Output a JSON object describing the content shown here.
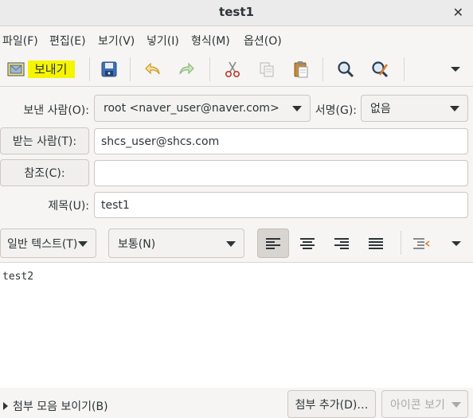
{
  "window": {
    "title": "test1"
  },
  "menu": [
    "파일(F)",
    "편집(E)",
    "보기(V)",
    "넣기(I)",
    "형식(M)",
    "옵션(O)"
  ],
  "toolbar": {
    "send_label": "보내기"
  },
  "header": {
    "from_label": "보낸 사람(O):",
    "from_value": "root <naver_user@naver.com>",
    "signature_label": "서명(G):",
    "signature_value": "없음",
    "to_button": "받는 사람(T):",
    "to_value": "shcs_user@shcs.com",
    "cc_button": "참조(C):",
    "cc_value": "",
    "subject_label": "제목(U):",
    "subject_value": "test1"
  },
  "format": {
    "mode": "일반 텍스트(T)",
    "paragraph": "보통(N)"
  },
  "body": {
    "text": "test2"
  },
  "bottom": {
    "show_attachments": "첨부 모음 보이기(B)",
    "add_attachment": "첨부 추가(D)…",
    "icon_view": "아이콘 보기"
  }
}
